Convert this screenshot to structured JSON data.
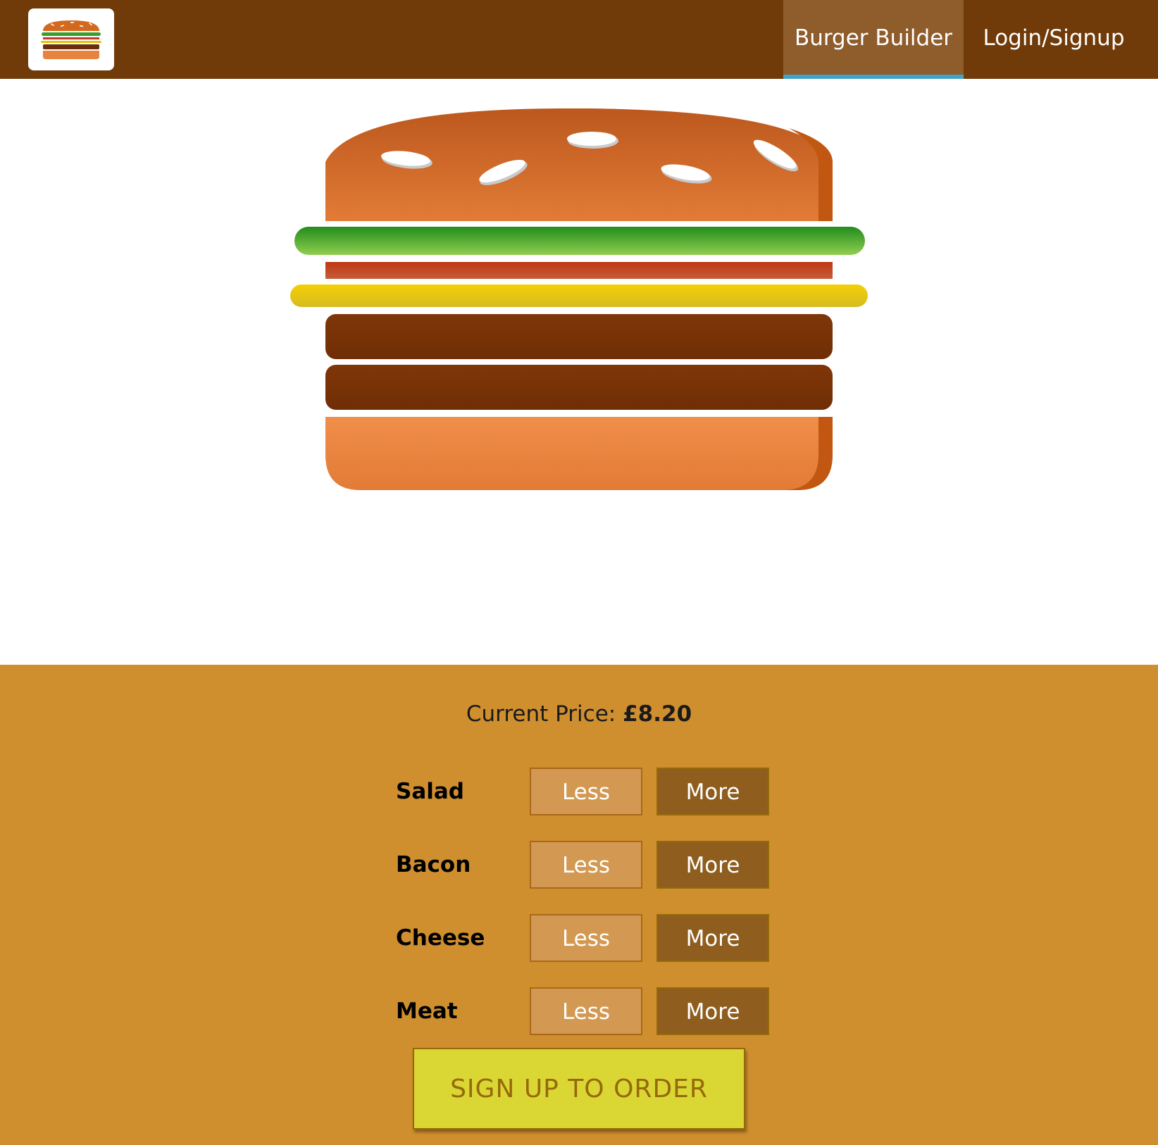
{
  "toolbar": {
    "logo_icon": "burger-logo-icon",
    "nav": [
      {
        "label": "Burger Builder",
        "active": true
      },
      {
        "label": "Login/Signup",
        "active": false
      }
    ]
  },
  "burger": {
    "layers": [
      "bread-top",
      "salad",
      "bacon",
      "cheese",
      "meat",
      "meat",
      "bread-bottom"
    ]
  },
  "controls": {
    "price_label": "Current Price: ",
    "price_value": "£8.20",
    "ingredients": [
      {
        "label": "Salad",
        "less": "Less",
        "more": "More"
      },
      {
        "label": "Bacon",
        "less": "Less",
        "more": "More"
      },
      {
        "label": "Cheese",
        "less": "Less",
        "more": "More"
      },
      {
        "label": "Meat",
        "less": "Less",
        "more": "More"
      }
    ],
    "order_button": "SIGN UP TO ORDER"
  },
  "colors": {
    "toolbar": "#703b09",
    "active_nav": "#8f5c2c",
    "active_underline": "#40a4c8",
    "controls_bg": "#cf8f2e",
    "less_button": "#d39952",
    "more_button": "#8f5e1e",
    "order_button": "#dad735"
  }
}
